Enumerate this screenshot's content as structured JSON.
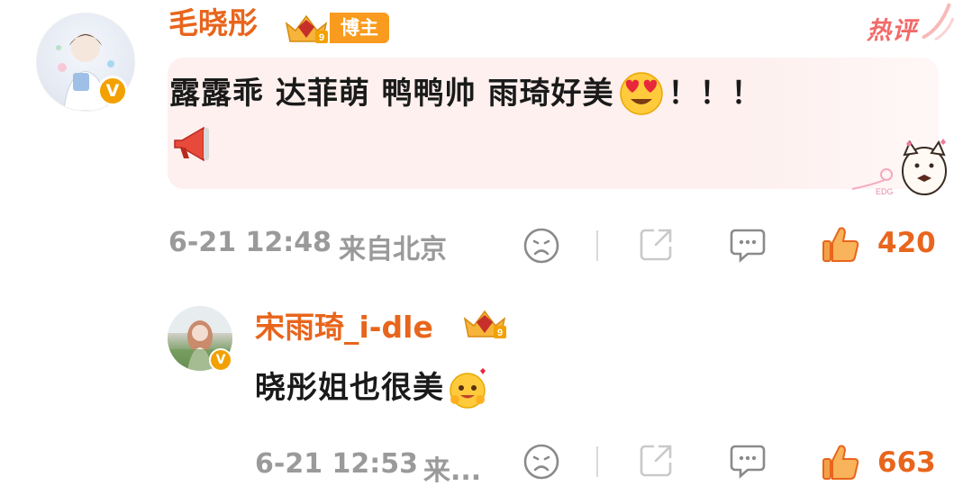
{
  "comment": {
    "username": "毛晓彤",
    "badge_label": "博主",
    "hot_tag": "热评",
    "text": "露露乖 达菲萌 鸭鸭帅 雨琦好美",
    "exclaim": "！！！",
    "date": "6-21 12:48",
    "location": "来自北京",
    "likes": "420",
    "sticker_label": "EDG"
  },
  "reply": {
    "username": "宋雨琦_i-dle",
    "text": "晓彤姐也很美",
    "date": "6-21 12:53",
    "location": "来...",
    "likes": "663"
  },
  "icons": {
    "verified": "V",
    "actions": [
      "sad-face-icon",
      "share-icon",
      "comment-icon",
      "thumbs-up-icon"
    ]
  },
  "colors": {
    "username": "#e8651c",
    "badge": "#f89b1e",
    "hot": "#f26a6a",
    "bubble": "#fdf0ee",
    "meta": "#9a9a9a"
  }
}
